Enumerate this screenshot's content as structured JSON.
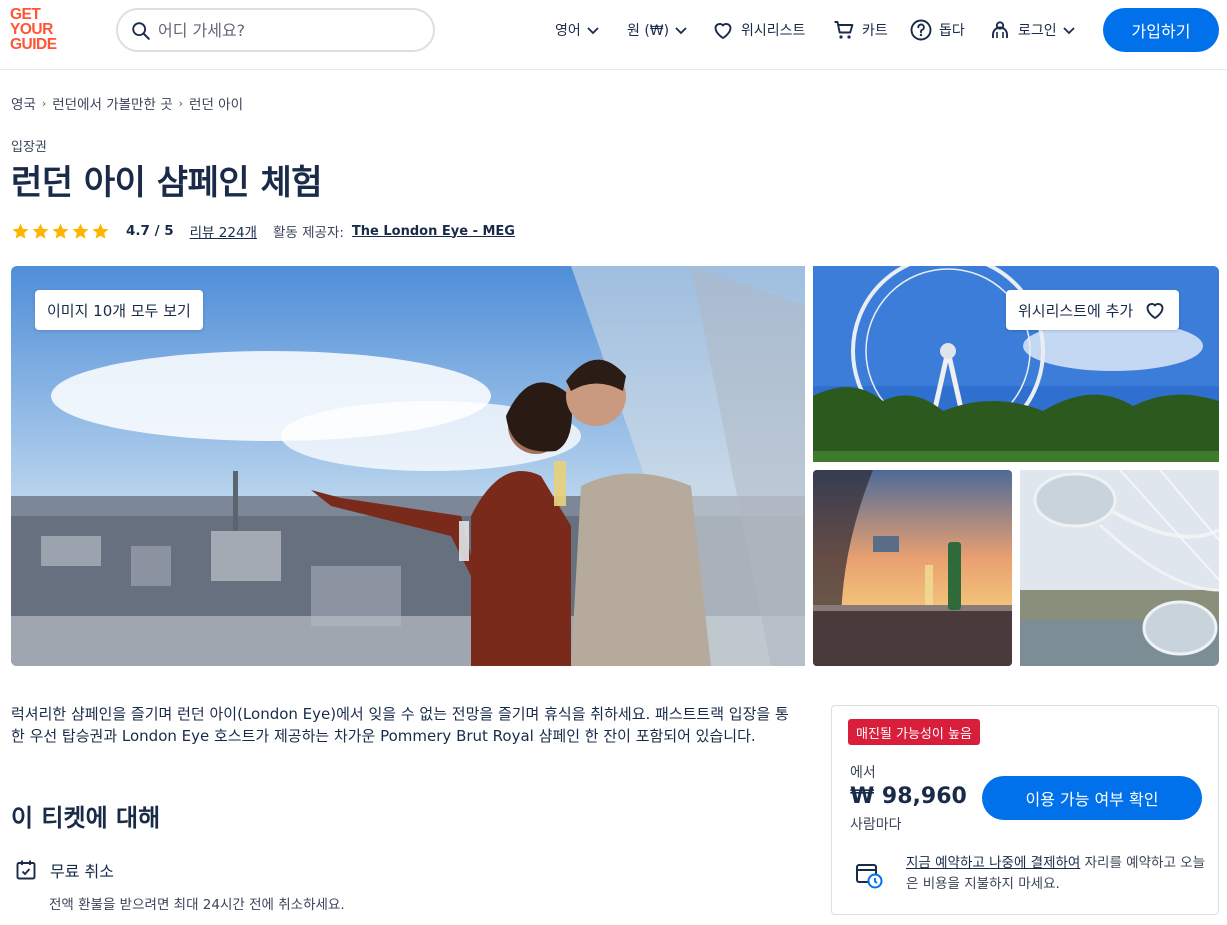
{
  "header": {
    "logo_lines": [
      "GET",
      "YOUR",
      "GUIDE"
    ],
    "search_placeholder": "어디 가세요?",
    "language": "영어",
    "currency": "원 (₩)",
    "wishlist": "위시리스트",
    "cart": "카트",
    "help": "돕다",
    "login": "로그인",
    "signup": "가입하기"
  },
  "breadcrumb": [
    "영국",
    "런던에서 가볼만한 곳",
    "런던 아이"
  ],
  "category": "입장권",
  "title": "런던 아이 샴페인 체험",
  "rating": {
    "stars": 5,
    "value": "4.7 / 5",
    "reviews": "리뷰 224개",
    "provider_label": "활동 제공자:",
    "provider": "The London Eye - MEG"
  },
  "gallery": {
    "view_all": "이미지 10개 모두 보기",
    "wishlist_add": "위시리스트에 추가"
  },
  "description": "럭셔리한 샴페인을 즐기며 런던 아이(London Eye)에서 잊을 수 없는 전망을 즐기며 휴식을 취하세요. 패스트트랙 입장을 통한 우선 탑승권과 London Eye 호스트가 제공하는 차가운 Pommery Brut Royal 샴페인 한 잔이 포함되어 있습니다.",
  "about": {
    "title": "이 티켓에 대해",
    "features": [
      {
        "title": "무료 취소",
        "subtitle": "전액 환불을 받으려면 최대 24시간 전에 취소하세요."
      }
    ]
  },
  "booking": {
    "badge": "매진될 가능성이 높음",
    "from": "에서",
    "price": "₩ 98,960",
    "per": "사람마다",
    "check_button": "이용 가능 여부 확인",
    "reserve_link": "지금 예약하고 나중에 결제하여",
    "reserve_text": " 자리를 예약하고 오늘은 비용을 지불하지 마세요."
  },
  "colors": {
    "brand": "#ff5533",
    "primary": "#0071eb",
    "text": "#1a2b49",
    "star": "#ffb400",
    "badge": "#d91e3c"
  }
}
